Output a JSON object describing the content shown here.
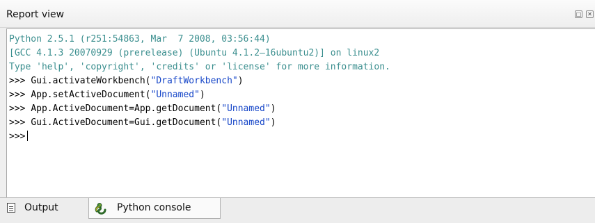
{
  "panel": {
    "title": "Report view",
    "float_icon": "restore-icon",
    "close_icon": "close-icon"
  },
  "console": {
    "banner": [
      "Python 2.5.1 (r251:54863, Mar  7 2008, 03:56:44)",
      "[GCC 4.1.3 20070929 (prerelease) (Ubuntu 4.1.2—16ubuntu2)] on linux2",
      "Type 'help', 'copyright', 'credits' or 'license' for more information."
    ],
    "prompt": ">>> ",
    "commands": [
      {
        "pre": "Gui.activateWorkbench(",
        "arg": "\"DraftWorkbench\"",
        "post": ")"
      },
      {
        "pre": "App.setActiveDocument(",
        "arg": "\"Unnamed\"",
        "post": ")"
      },
      {
        "pre": "App.ActiveDocument=App.getDocument(",
        "arg": "\"Unnamed\"",
        "post": ")"
      },
      {
        "pre": "Gui.ActiveDocument=Gui.getDocument(",
        "arg": "\"Unnamed\"",
        "post": ")"
      }
    ],
    "current_prompt": ">>>"
  },
  "tabs": [
    {
      "label": "Output",
      "icon": "document-icon",
      "active": false
    },
    {
      "label": "Python console",
      "icon": "python-icon",
      "active": true
    }
  ],
  "colors": {
    "banner_text": "#3a8e8e",
    "string_literal": "#1646c8",
    "command_text": "#000000"
  }
}
